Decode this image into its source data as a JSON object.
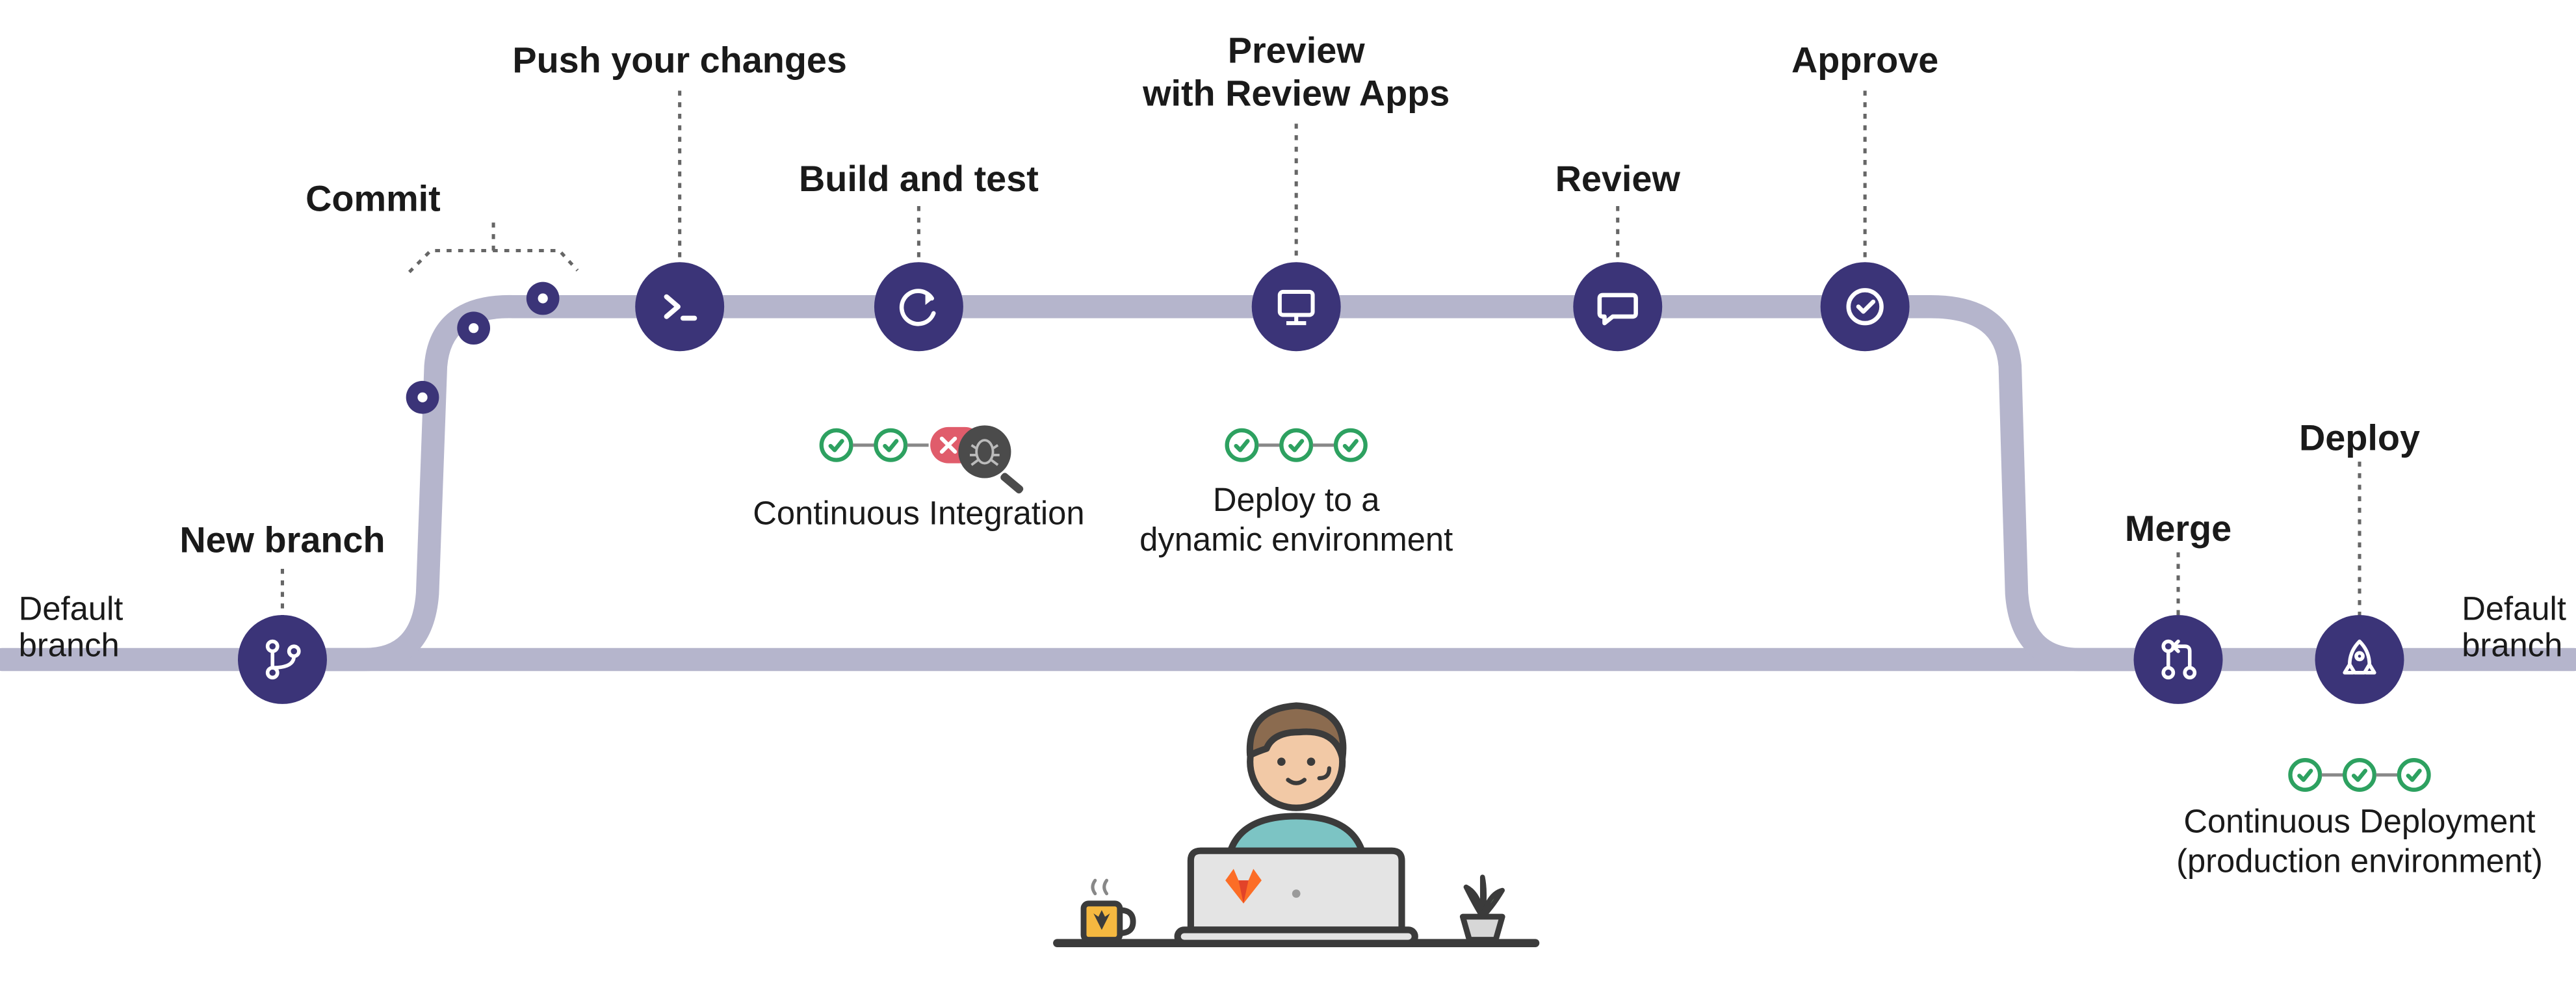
{
  "labels": {
    "default_branch_left": "Default\nbranch",
    "default_branch_right": "Default\nbranch",
    "new_branch": "New branch",
    "commit": "Commit",
    "push": "Push your changes",
    "build_test": "Build and test",
    "ci_caption": "Continuous Integration",
    "preview_line1": "Preview",
    "preview_line2": "with Review Apps",
    "deploy_caption_line1": "Deploy to a",
    "deploy_caption_line2": "dynamic environment",
    "review": "Review",
    "approve": "Approve",
    "merge": "Merge",
    "deploy": "Deploy",
    "cd_caption_line1": "Continuous Deployment",
    "cd_caption_line2": "(production environment)"
  },
  "colors": {
    "node": "#3B3478",
    "pipe": "#B5B5CC",
    "pass": "#2DA160",
    "fail": "#E05C6B",
    "text": "#1a1a1a"
  }
}
